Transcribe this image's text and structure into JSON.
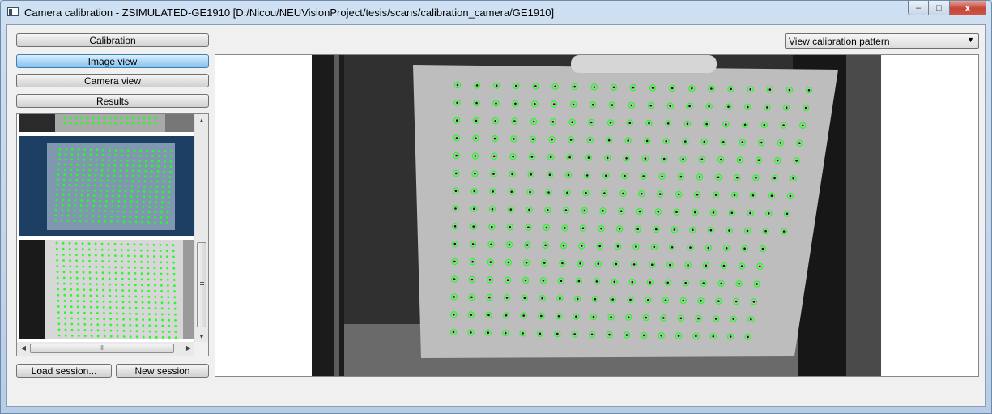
{
  "window": {
    "title": "Camera calibration - ZSIMULATED-GE1910 [D:/Nicou/NEUVisionProject/tesis/scans/calibration_camera/GE1910]",
    "minimize_glyph": "–",
    "maximize_glyph": "□",
    "close_glyph": "x"
  },
  "sidebar": {
    "calibration_label": "Calibration",
    "image_view_label": "Image view",
    "camera_view_label": "Camera view",
    "results_label": "Results",
    "load_session_label": "Load session...",
    "new_session_label": "New session"
  },
  "scrollbars": {
    "up_glyph": "▲",
    "down_glyph": "▼",
    "left_glyph": "◀",
    "right_glyph": "▶",
    "grip_glyph": "III"
  },
  "viewer": {
    "mode_selected": "View calibration pattern",
    "pattern_rows": 15,
    "pattern_cols": 19
  },
  "colors": {
    "accent_active": "#86c2ee",
    "detected_point": "#21ff21"
  }
}
